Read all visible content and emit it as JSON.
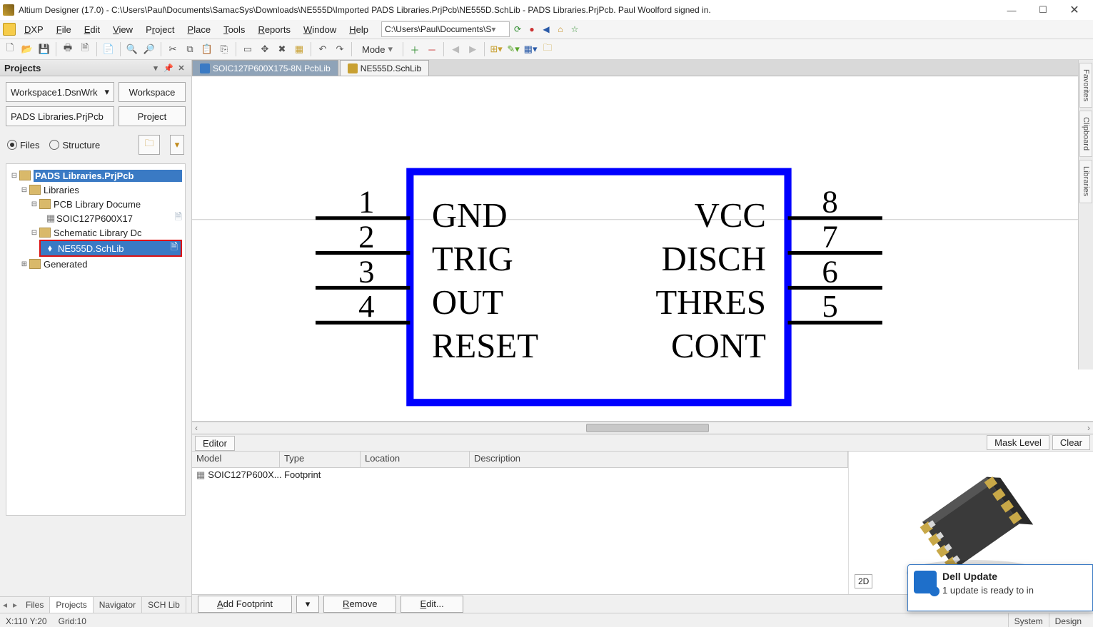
{
  "title": "Altium Designer (17.0) - C:\\Users\\Paul\\Documents\\SamacSys\\Downloads\\NE555D\\Imported PADS Libraries.PrjPcb\\NE555D.SchLib - PADS Libraries.PrjPcb. Paul Woolford signed in.",
  "menu": {
    "dxp": "DXP",
    "file": "File",
    "edit": "Edit",
    "view": "View",
    "project": "Project",
    "place": "Place",
    "tools": "Tools",
    "reports": "Reports",
    "window": "Window",
    "help": "Help"
  },
  "pathbox": "C:\\Users\\Paul\\Documents\\S",
  "toolbar": {
    "mode": "Mode"
  },
  "projects": {
    "title": "Projects",
    "workspace_combo": "Workspace1.DsnWrk",
    "workspace_btn": "Workspace",
    "project_field": "PADS Libraries.PrjPcb",
    "project_btn": "Project",
    "radio_files": "Files",
    "radio_structure": "Structure",
    "tree": {
      "root": "PADS Libraries.PrjPcb",
      "libraries": "Libraries",
      "pcblib": "PCB Library Docume",
      "pcbitem": "SOIC127P600X17",
      "schlib": "Schematic Library Dc",
      "schitem": "NE555D.SchLib",
      "generated": "Generated"
    },
    "bottom": {
      "files": "Files",
      "projects": "Projects",
      "navigator": "Navigator",
      "schlib": "SCH Lib"
    }
  },
  "tabs": {
    "t1": "SOIC127P600X175-8N.PcbLib",
    "t2": "NE555D.SchLib"
  },
  "schematic": {
    "pins_left": [
      {
        "num": "1",
        "name": "GND"
      },
      {
        "num": "2",
        "name": "TRIG"
      },
      {
        "num": "3",
        "name": "OUT"
      },
      {
        "num": "4",
        "name": "RESET"
      }
    ],
    "pins_right": [
      {
        "num": "8",
        "name": "VCC"
      },
      {
        "num": "7",
        "name": "DISCH"
      },
      {
        "num": "6",
        "name": "THRES"
      },
      {
        "num": "5",
        "name": "CONT"
      }
    ]
  },
  "editor": {
    "tab": "Editor",
    "mask": "Mask Level",
    "clear": "Clear",
    "cols": {
      "model": "Model",
      "type": "Type",
      "location": "Location",
      "description": "Description"
    },
    "row": {
      "model": "SOIC127P600X...",
      "type": "Footprint",
      "location": "",
      "description": ""
    },
    "foot": {
      "add": "Add Footprint",
      "remove": "Remove",
      "edit": "Edit..."
    },
    "badge": "2D"
  },
  "vtabs": {
    "fav": "Favorites",
    "clip": "Clipboard",
    "lib": "Libraries"
  },
  "status": {
    "xy": "X:110 Y:20",
    "grid": "Grid:10",
    "system": "System",
    "design": "Design"
  },
  "toast": {
    "title": "Dell Update",
    "sub": "1 update is ready to in"
  }
}
